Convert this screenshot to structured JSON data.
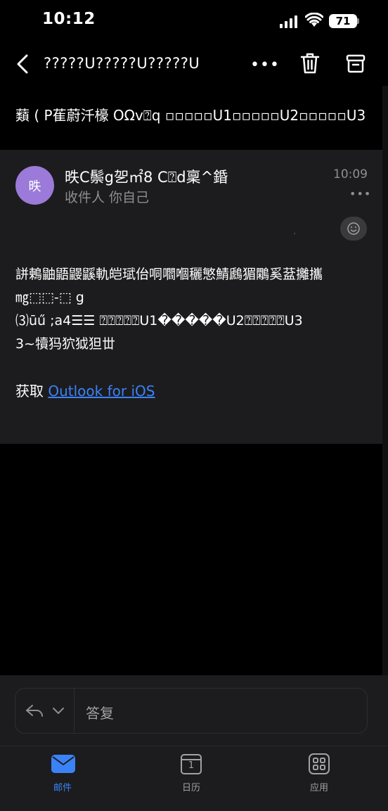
{
  "status_bar": {
    "time": "10:12",
    "battery": "71"
  },
  "top_bar": {
    "title": "?????U?????U?????U",
    "more_label": "•••"
  },
  "email": {
    "subject": "蘱 ( P萑蔚汘檺 OΩv⍰q ▫▫▫▫▫U1▫▫▫▫▫U2▫▫▫▫▫U3",
    "sender": "昳C鬃g乫㎡8 C⍰d稟^錉",
    "avatar_initial": "昳",
    "recipient": "收件人 你自己",
    "time": "10:09",
    "more_label": "•••",
    "body_lines": [
      "誁鶇鼬鼯鼹鼷軌皑珷佁哃嚪嗰穲慜鯖鷉猸鷴奚葐攡攜",
      "㎎⬚⬚-⬚ g",
      "⑶ūű ;a4☰☰ ⍰⍰⍰⍰⍰U1�����U2⍰⍰⍰⍰⍰U3",
      "3~犢犸狖狘狚丗"
    ],
    "get_prefix": "获取",
    "get_link": "Outlook for iOS"
  },
  "reply": {
    "label": "答复"
  },
  "tabs": [
    {
      "label": "邮件",
      "active": true
    },
    {
      "label": "日历",
      "active": false,
      "day": "1"
    },
    {
      "label": "应用",
      "active": false
    }
  ],
  "colors": {
    "accent": "#3b82f6",
    "avatar": "#9b7ad9",
    "secondary_text": "#8e8e93"
  }
}
